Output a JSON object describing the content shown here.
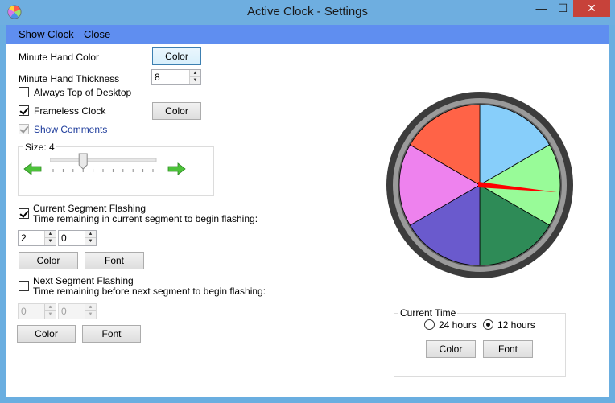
{
  "window": {
    "title": "Active Clock - Settings",
    "minimize_glyph": "—",
    "maximize_glyph": "☐",
    "close_glyph": "✕"
  },
  "menu": {
    "items": [
      "Show Clock",
      "Close"
    ]
  },
  "settings": {
    "minute_hand_color_label": "Minute Hand Color",
    "minute_hand_color_button": "Color",
    "minute_hand_thickness_label": "Minute Hand Thickness",
    "minute_hand_thickness_value": "8",
    "always_top_label": "Always Top of Desktop",
    "always_top_checked": false,
    "frameless_label": "Frameless Clock",
    "frameless_checked": true,
    "frameless_color_button": "Color",
    "show_comments_label": "Show Comments",
    "show_comments_checked": true,
    "show_comments_enabled": false
  },
  "size": {
    "label": "Size: 4",
    "value": 4,
    "fraction": 0.3
  },
  "current_segment": {
    "checkbox_label": "Current Segment Flashing",
    "checked": true,
    "description": "Time remaining in current segment to begin flashing:",
    "value_1": "2",
    "value_2": "0",
    "color_button": "Color",
    "font_button": "Font"
  },
  "next_segment": {
    "checkbox_label": "Next Segment Flashing",
    "checked": false,
    "description": "Time remaining before next segment to begin flashing:",
    "value_1": "0",
    "value_2": "0",
    "color_button": "Color",
    "font_button": "Font"
  },
  "current_time": {
    "group_title": "Current Time",
    "option_24": "24 hours",
    "option_12": "12 hours",
    "selected": "12 hours",
    "color_button": "Color",
    "font_button": "Font"
  },
  "clock_preview": {
    "segment_colors": [
      "#87cefa",
      "#98fb98",
      "#2e8b57",
      "#6a5acd",
      "#ee82ee",
      "#ff6347"
    ],
    "hand_color": "#ff0000"
  },
  "colors": {
    "titlebar": "#6eaee0",
    "menubar": "#5f8ef0",
    "close_button": "#c7423a"
  }
}
